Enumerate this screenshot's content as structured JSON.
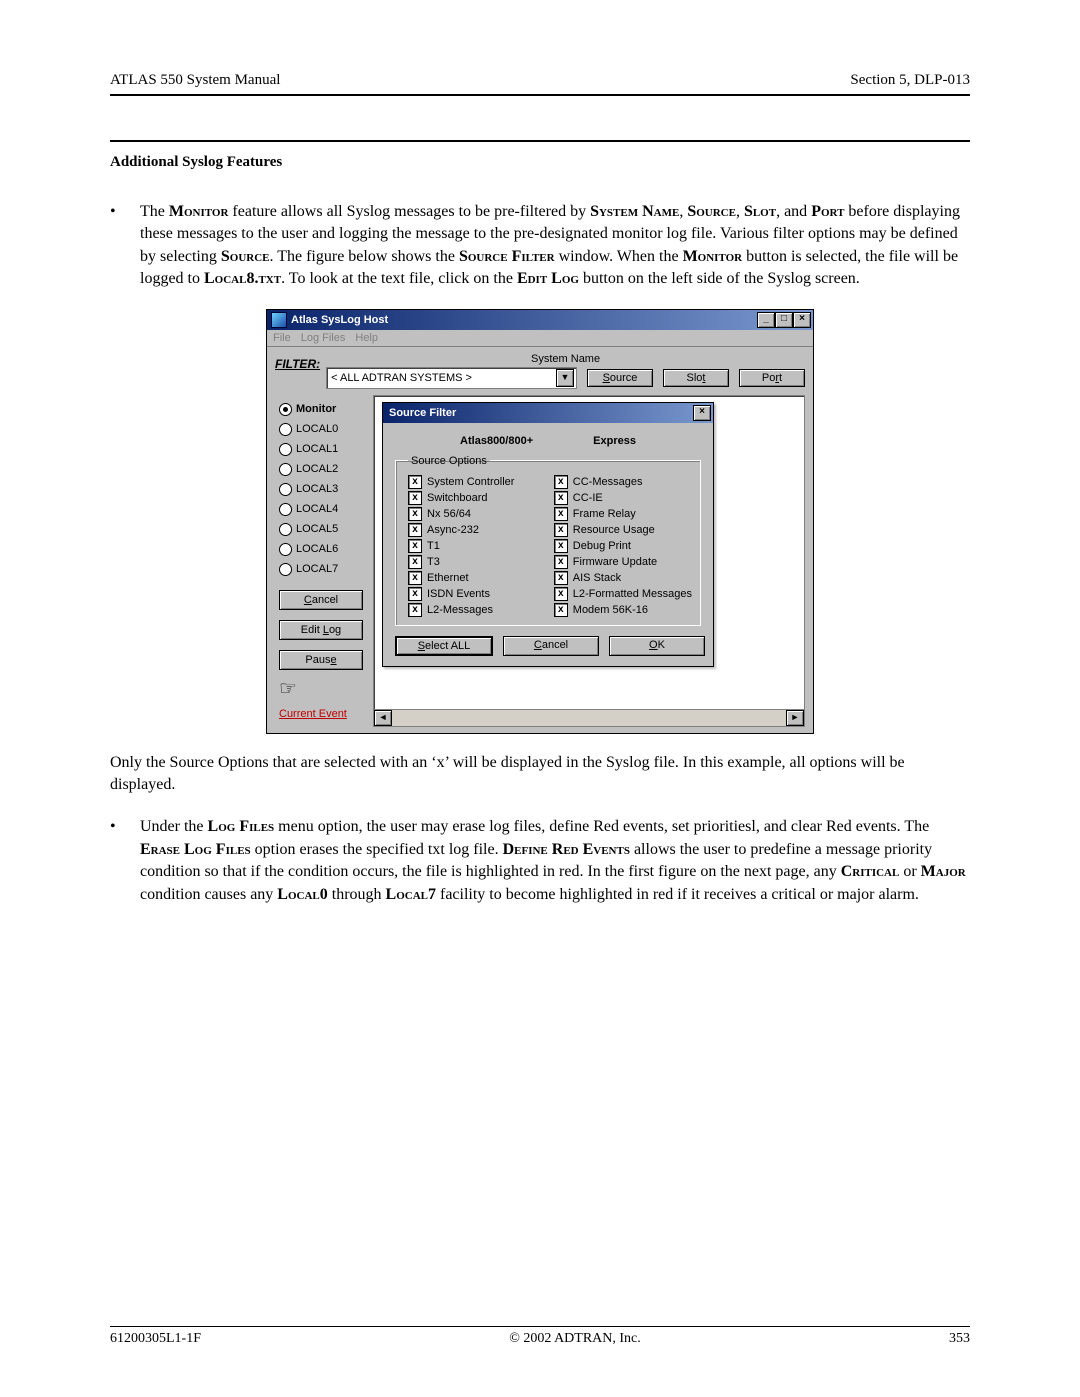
{
  "header": {
    "left": "ATLAS 550 System Manual",
    "right": "Section 5, DLP-013"
  },
  "section_heading": "Additional Syslog Features",
  "para1_parts": {
    "a": "The ",
    "monitor": "Monitor",
    "b": " feature allows all Syslog messages to be pre-filtered by ",
    "sysname": "System Name",
    "c": ", ",
    "source": "Source",
    "d": ", ",
    "slot": "Slot",
    "e": ", and ",
    "port": "Port",
    "f": " before displaying these messages to the user and logging the message to the pre-designated monitor log file. Various filter options may be defined by selecting ",
    "source2": "Source",
    "g": ". The figure below shows the ",
    "srcfilter": "Source Filter",
    "h": " window. When the ",
    "monitor2": "Monitor",
    "i": " button is selected, the file will be logged to ",
    "local8": "Local8.txt",
    "j": ". To look at the text file, click on the ",
    "editlog": "Edit Log",
    "k": " button on the left side of the Syslog screen."
  },
  "app": {
    "title": "Atlas SysLog Host",
    "menus": [
      "File",
      "Log Files",
      "Help"
    ],
    "filter_label": "FILTER:",
    "sysname_label": "System Name",
    "combo_value": "< ALL ADTRAN SYSTEMS >",
    "top_buttons": {
      "source": "Source",
      "slot": "Slot",
      "port": "Port"
    },
    "radios": [
      {
        "label": "Monitor",
        "selected": true,
        "bold": true
      },
      {
        "label": "LOCAL0",
        "selected": false
      },
      {
        "label": "LOCAL1",
        "selected": false
      },
      {
        "label": "LOCAL2",
        "selected": false
      },
      {
        "label": "LOCAL3",
        "selected": false
      },
      {
        "label": "LOCAL4",
        "selected": false
      },
      {
        "label": "LOCAL5",
        "selected": false
      },
      {
        "label": "LOCAL6",
        "selected": false
      },
      {
        "label": "LOCAL7",
        "selected": false
      }
    ],
    "left_buttons": {
      "cancel": "Cancel",
      "editlog": "Edit Log",
      "pause": "Pause"
    },
    "current_event": "Current Event"
  },
  "dlg": {
    "title": "Source Filter",
    "hdr_left": "Atlas800/800+",
    "hdr_right": "Express",
    "group_title": "Source Options",
    "options_col1": [
      "System Controller",
      "Switchboard",
      "Nx 56/64",
      "Async-232",
      "T1",
      "T3",
      "Ethernet",
      "ISDN Events",
      "L2-Messages"
    ],
    "options_col2": [
      "CC-Messages",
      "CC-IE",
      "Frame Relay",
      "Resource Usage",
      "Debug Print",
      "Firmware Update",
      "AIS Stack",
      "L2-Formatted Messages",
      "Modem 56K-16"
    ],
    "buttons": {
      "select_all": "Select ALL",
      "cancel": "Cancel",
      "ok": "OK"
    }
  },
  "after_fig": "Only the Source Options that are selected with an ‘x’ will be displayed in the Syslog file. In this example, all options will be displayed.",
  "para2_parts": {
    "a": "Under the ",
    "logfiles": "Log Files",
    "b": " menu option, the user may erase log files, define Red events, set prioritiesl, and clear Red events. The ",
    "erase": "Erase Log Files",
    "c": " option erases the specified txt log file. ",
    "define": "Define Red Events",
    "d": " allows the user to predefine a message priority condition so that if the condition occurs, the file is highlighted in red. In the first figure on the next page, any ",
    "critical": "Critical",
    "e": " or ",
    "major": "Major",
    "f": " condition causes any ",
    "local0": "Local0",
    "g": " through ",
    "local7": "Local7",
    "h": " facility to become highlighted in red if it receives a critical or major alarm."
  },
  "footer": {
    "left": "61200305L1-1F",
    "center": "© 2002 ADTRAN, Inc.",
    "right": "353"
  }
}
